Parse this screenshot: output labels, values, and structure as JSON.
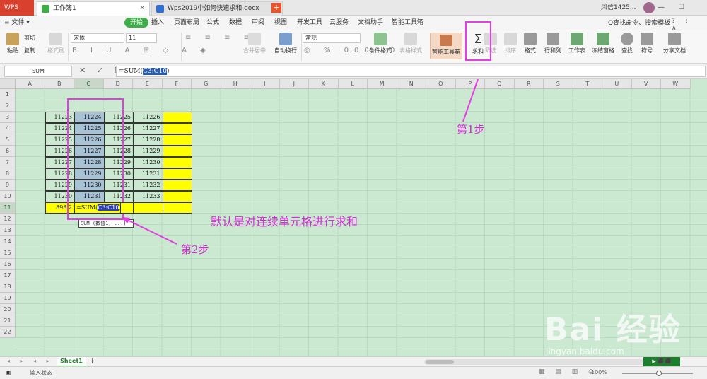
{
  "titlebar": {
    "app": "WPS",
    "active_tab": "工作簿1",
    "doc_tab": "Wps2019中如何快速求和.docx",
    "user": "风信1425...",
    "win_controls": "— ☐ ✕"
  },
  "menu": {
    "file": "≡ 文件 ▾",
    "items": [
      "开始",
      "插入",
      "页面布局",
      "公式",
      "数据",
      "审阅",
      "视图",
      "开发工具",
      "云服务",
      "文档助手",
      "智能工具箱"
    ],
    "search": "Q查找命令、搜索模板",
    "help": "? : ∧"
  },
  "ribbon": {
    "paste": "粘贴",
    "cut": "剪切",
    "copy": "复制",
    "format_painter": "格式刷",
    "font_name": "宋体",
    "font_size": "11",
    "merge": "合并居中",
    "wrap": "自动换行",
    "number_format": "常规",
    "cond_format": "条件格式",
    "table_style": "表格样式",
    "smart_toolbox": "智能工具箱",
    "sum": "求和",
    "filter": "筛选",
    "sort": "排序",
    "format": "格式",
    "rowcol": "行和列",
    "worksheet": "工作表",
    "freeze": "冻结窗格",
    "find": "查找",
    "symbol": "符号",
    "share": "分享文档"
  },
  "formula_bar": {
    "name_box": "SUM",
    "fx_buttons": "✕ ✓ fx",
    "prefix": "=SUM(",
    "ref": "C3:C10",
    "suffix": ")"
  },
  "columns": [
    "A",
    "B",
    "C",
    "D",
    "E",
    "F",
    "G",
    "H",
    "I",
    "J",
    "K",
    "L",
    "M",
    "N",
    "O",
    "P",
    "Q",
    "R",
    "S",
    "T",
    "U",
    "V",
    "W"
  ],
  "rows": [
    "1",
    "2",
    "3",
    "4",
    "5",
    "6",
    "7",
    "8",
    "9",
    "10",
    "11",
    "12",
    "13",
    "14",
    "15",
    "16",
    "17",
    "18",
    "19",
    "20",
    "21",
    "22"
  ],
  "table": {
    "B": [
      "11223",
      "11224",
      "11225",
      "11226",
      "11227",
      "11228",
      "11229",
      "11230"
    ],
    "C": [
      "11224",
      "11225",
      "11226",
      "11227",
      "11228",
      "11229",
      "11230",
      "11231"
    ],
    "D": [
      "11225",
      "11226",
      "11227",
      "11228",
      "11229",
      "11230",
      "11231",
      "11232"
    ],
    "E": [
      "11226",
      "11227",
      "11228",
      "11229",
      "11230",
      "11231",
      "11232",
      "11233"
    ],
    "b11": "898",
    "b11_tail": "2",
    "formula_prefix": "=SUM(",
    "formula_ref": "C3:C10",
    "formula_suffix": ")"
  },
  "tooltip": "SUM (数值1, ...)",
  "annotations": {
    "step1": "第1步",
    "step2": "第2步",
    "note": "默认是对连续单元格进行求和"
  },
  "watermark": {
    "brand": "Bai 经验",
    "url": "jingyan.baidu.com"
  },
  "sheets": [
    "Sheet1"
  ],
  "status": {
    "text": "输入状态",
    "zoom": "100%"
  },
  "colors": {
    "accent": "#3fae49",
    "annotation": "#e23ee2",
    "grid_bg": "#cbe8d1",
    "highlight_yellow": "#ffff00",
    "selection_blue": "#a9c3d6"
  }
}
